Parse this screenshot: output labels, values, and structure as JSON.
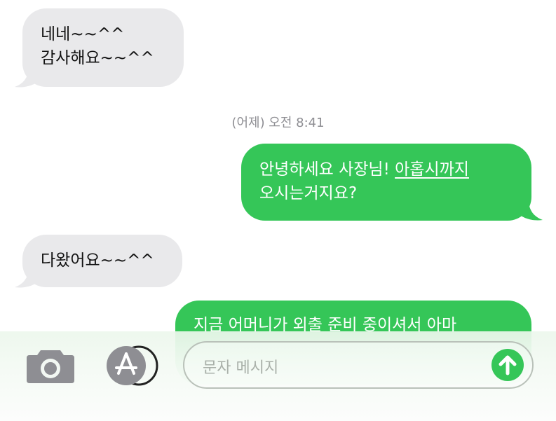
{
  "messages": [
    {
      "lines": [
        "네네~~^^",
        "감사해요~~^^"
      ]
    },
    {
      "lines": [
        "안녕하세요 사장님! ",
        "아홉시까지",
        "오시는거지요?"
      ]
    },
    {
      "lines": [
        "다왔어요~~^^"
      ]
    },
    {
      "lines": [
        "지금 어머니가 외출 준비 중이셔서 아마"
      ]
    }
  ],
  "timestamp": "(어제) 오전 8:41",
  "composer": {
    "placeholder": "문자 메시지",
    "camera_icon": "camera-icon",
    "apps_icon": "app-store-icon",
    "send_icon": "send-arrow-icon"
  },
  "colors": {
    "sent": "#35c658",
    "received": "#e9e9eb"
  }
}
